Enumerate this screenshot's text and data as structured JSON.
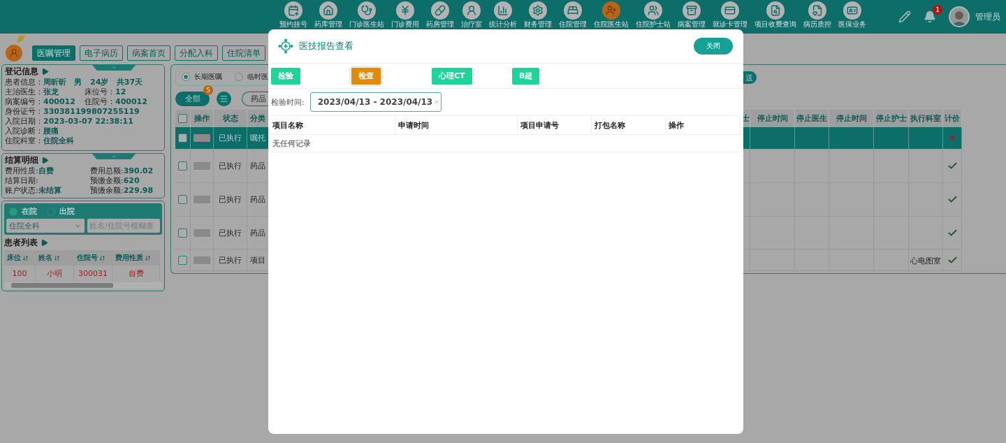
{
  "nav": {
    "items": [
      {
        "label": "预约挂号",
        "selected": false
      },
      {
        "label": "药库管理",
        "selected": false
      },
      {
        "label": "门诊医生站",
        "selected": false
      },
      {
        "label": "门诊费用",
        "selected": false
      },
      {
        "label": "药房管理",
        "selected": false
      },
      {
        "label": "治疗室",
        "selected": false
      },
      {
        "label": "统计分析",
        "selected": false
      },
      {
        "label": "财务管理",
        "selected": false
      },
      {
        "label": "住院管理",
        "selected": false
      },
      {
        "label": "住院医生站",
        "selected": true
      },
      {
        "label": "住院护士站",
        "selected": false
      },
      {
        "label": "病案管理",
        "selected": false
      },
      {
        "label": "就诊卡管理",
        "selected": false
      },
      {
        "label": "项目收费查询",
        "selected": false
      },
      {
        "label": "病历质控",
        "selected": false
      },
      {
        "label": "医保业务",
        "selected": false
      }
    ],
    "notification_count": "1",
    "user": "管理员"
  },
  "page_tabs": [
    {
      "label": "医嘱管理",
      "selected": true
    },
    {
      "label": "电子病历",
      "selected": false
    },
    {
      "label": "病案首页",
      "selected": false
    },
    {
      "label": "分配入科",
      "selected": false
    },
    {
      "label": "住院清单",
      "selected": false
    }
  ],
  "registration": {
    "title": "登记信息",
    "rows": [
      [
        {
          "label": "患者信息：",
          "value": "周昕昕   男   24岁   共37天"
        }
      ],
      [
        {
          "label": "主治医生：",
          "value": "张龙"
        },
        {
          "label": "床位号：",
          "value": "12"
        }
      ],
      [
        {
          "label": "病案编号：",
          "value": "400012"
        },
        {
          "label": "住院号：",
          "value": "400012"
        }
      ],
      [
        {
          "label": "身份证号：",
          "value": "330381199807255119"
        }
      ],
      [
        {
          "label": "入院日期：",
          "value": "2023-03-07 22:38:11"
        }
      ],
      [
        {
          "label": "入院诊断：",
          "value": "腰痛"
        }
      ],
      [
        {
          "label": "住院科室：",
          "value": "住院全科"
        }
      ]
    ]
  },
  "settlement": {
    "title": "结算明细",
    "rows": [
      [
        {
          "label": "费用性质:",
          "value": "自费"
        },
        {
          "label": "费用总额:",
          "value": "390.02"
        }
      ],
      [
        {
          "label": "结算日期:"
        },
        {
          "label": "预缴金额:",
          "value": "620"
        }
      ],
      [
        {
          "label": "账户状态:",
          "value": "未结算"
        },
        {
          "label": "预缴余额:",
          "value": "229.98"
        }
      ]
    ]
  },
  "patient_filter": {
    "statuses": [
      {
        "label": "在院",
        "selected": true
      },
      {
        "label": "出院",
        "selected": false
      }
    ],
    "department": "住院全科",
    "search": {
      "placeholder": "姓名/住院号模糊查"
    }
  },
  "patient_list": {
    "title": "患者列表",
    "columns": [
      "床位",
      "姓名",
      "住院号",
      "费用性质"
    ],
    "rows": [
      [
        "100",
        "小明",
        "300031",
        "自费"
      ]
    ]
  },
  "orders": {
    "types": [
      {
        "label": "长期医嘱",
        "selected": true
      },
      {
        "label": "临时医",
        "selected": false
      }
    ],
    "select_all_checked": false,
    "all_button": {
      "label": "全部",
      "count": "5"
    },
    "category_button": "药品",
    "send_button": "送",
    "left_columns": [
      "操作",
      "状态",
      "分类"
    ],
    "right_columns": [
      "士",
      "停止时间",
      "停止医生",
      "停止时间",
      "停止护士",
      "执行科室",
      "计价"
    ],
    "rows": [
      {
        "selected": true,
        "checked": false,
        "status": "已执行",
        "category": "嘱托",
        "priced": false
      },
      {
        "selected": false,
        "checked": false,
        "status": "已执行",
        "category": "药品",
        "priced": true
      },
      {
        "selected": false,
        "checked": false,
        "status": "已执行",
        "category": "药品",
        "priced": true
      },
      {
        "selected": false,
        "checked": false,
        "status": "已执行",
        "category": "药品",
        "priced": true
      },
      {
        "selected": false,
        "checked": false,
        "status": "已执行",
        "category": "项目",
        "dept": "心电图室",
        "priced": true
      }
    ]
  },
  "modal": {
    "title": "医技报告查看",
    "close": "关闭",
    "tabs": [
      {
        "label": "检验",
        "selected": false
      },
      {
        "label": "检查",
        "selected": true
      },
      {
        "label": "心理CT",
        "selected": false
      },
      {
        "label": "B超",
        "selected": false
      }
    ],
    "date_label": "检验时间:",
    "date_range": "2023/04/13 - 2023/04/13",
    "columns": [
      "项目名称",
      "申请时间",
      "项目申请号",
      "打包名称",
      "操作"
    ],
    "empty_text": "无任何记录"
  }
}
